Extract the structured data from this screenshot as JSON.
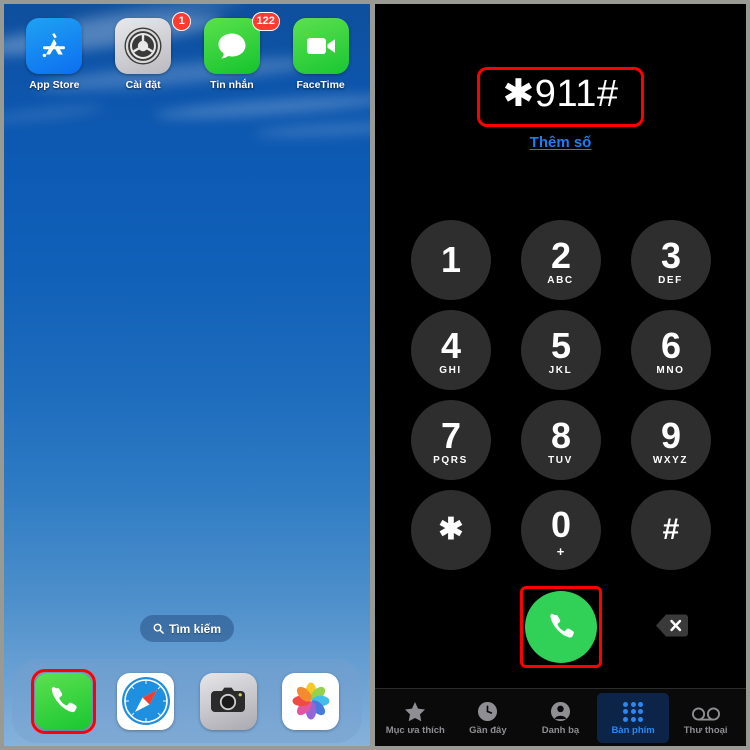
{
  "home": {
    "apps": [
      {
        "label": "App Store",
        "icon": "app-store-icon",
        "badge": null
      },
      {
        "label": "Cài đặt",
        "icon": "settings-gear-icon",
        "badge": "1"
      },
      {
        "label": "Tin nhắn",
        "icon": "messages-icon",
        "badge": "122"
      },
      {
        "label": "FaceTime",
        "icon": "facetime-icon",
        "badge": null
      }
    ],
    "search": {
      "label": "Tìm kiếm",
      "icon": "search-icon"
    },
    "dock": [
      {
        "label": "Phone",
        "icon": "phone-icon",
        "highlighted": true
      },
      {
        "label": "Safari",
        "icon": "safari-icon",
        "highlighted": false
      },
      {
        "label": "Camera",
        "icon": "camera-icon",
        "highlighted": false
      },
      {
        "label": "Photos",
        "icon": "photos-icon",
        "highlighted": false
      }
    ],
    "colors": {
      "wallpaper_top": "#0f4f9c",
      "wallpaper_bottom": "#86b2dc",
      "badge": "#ff3b30"
    }
  },
  "dialer": {
    "number": "✱911#",
    "add_number_label": "Thêm số",
    "keys": [
      {
        "digit": "1",
        "letters": ""
      },
      {
        "digit": "2",
        "letters": "ABC"
      },
      {
        "digit": "3",
        "letters": "DEF"
      },
      {
        "digit": "4",
        "letters": "GHI"
      },
      {
        "digit": "5",
        "letters": "JKL"
      },
      {
        "digit": "6",
        "letters": "MNO"
      },
      {
        "digit": "7",
        "letters": "PQRS"
      },
      {
        "digit": "8",
        "letters": "TUV"
      },
      {
        "digit": "9",
        "letters": "WXYZ"
      },
      {
        "digit": "✱",
        "letters": ""
      },
      {
        "digit": "0",
        "letters": "+"
      },
      {
        "digit": "#",
        "letters": ""
      }
    ],
    "call_button": {
      "icon": "phone-handset-icon",
      "highlighted": true
    },
    "delete_button": {
      "icon": "backspace-delete-icon"
    },
    "tabs": [
      {
        "label": "Mục ưa thích",
        "icon": "star-icon",
        "active": false
      },
      {
        "label": "Gần đây",
        "icon": "clock-icon",
        "active": false
      },
      {
        "label": "Danh bạ",
        "icon": "contacts-icon",
        "active": false
      },
      {
        "label": "Bàn phím",
        "icon": "keypad-dots-icon",
        "active": true
      },
      {
        "label": "Thư thoại",
        "icon": "voicemail-icon",
        "active": false
      }
    ],
    "colors": {
      "background": "#000000",
      "key": "#2e2e2e",
      "call_green": "#31d158",
      "highlight_red": "#ff0000",
      "link_blue": "#1f7df4",
      "active_tab": "#2b88f0"
    }
  }
}
